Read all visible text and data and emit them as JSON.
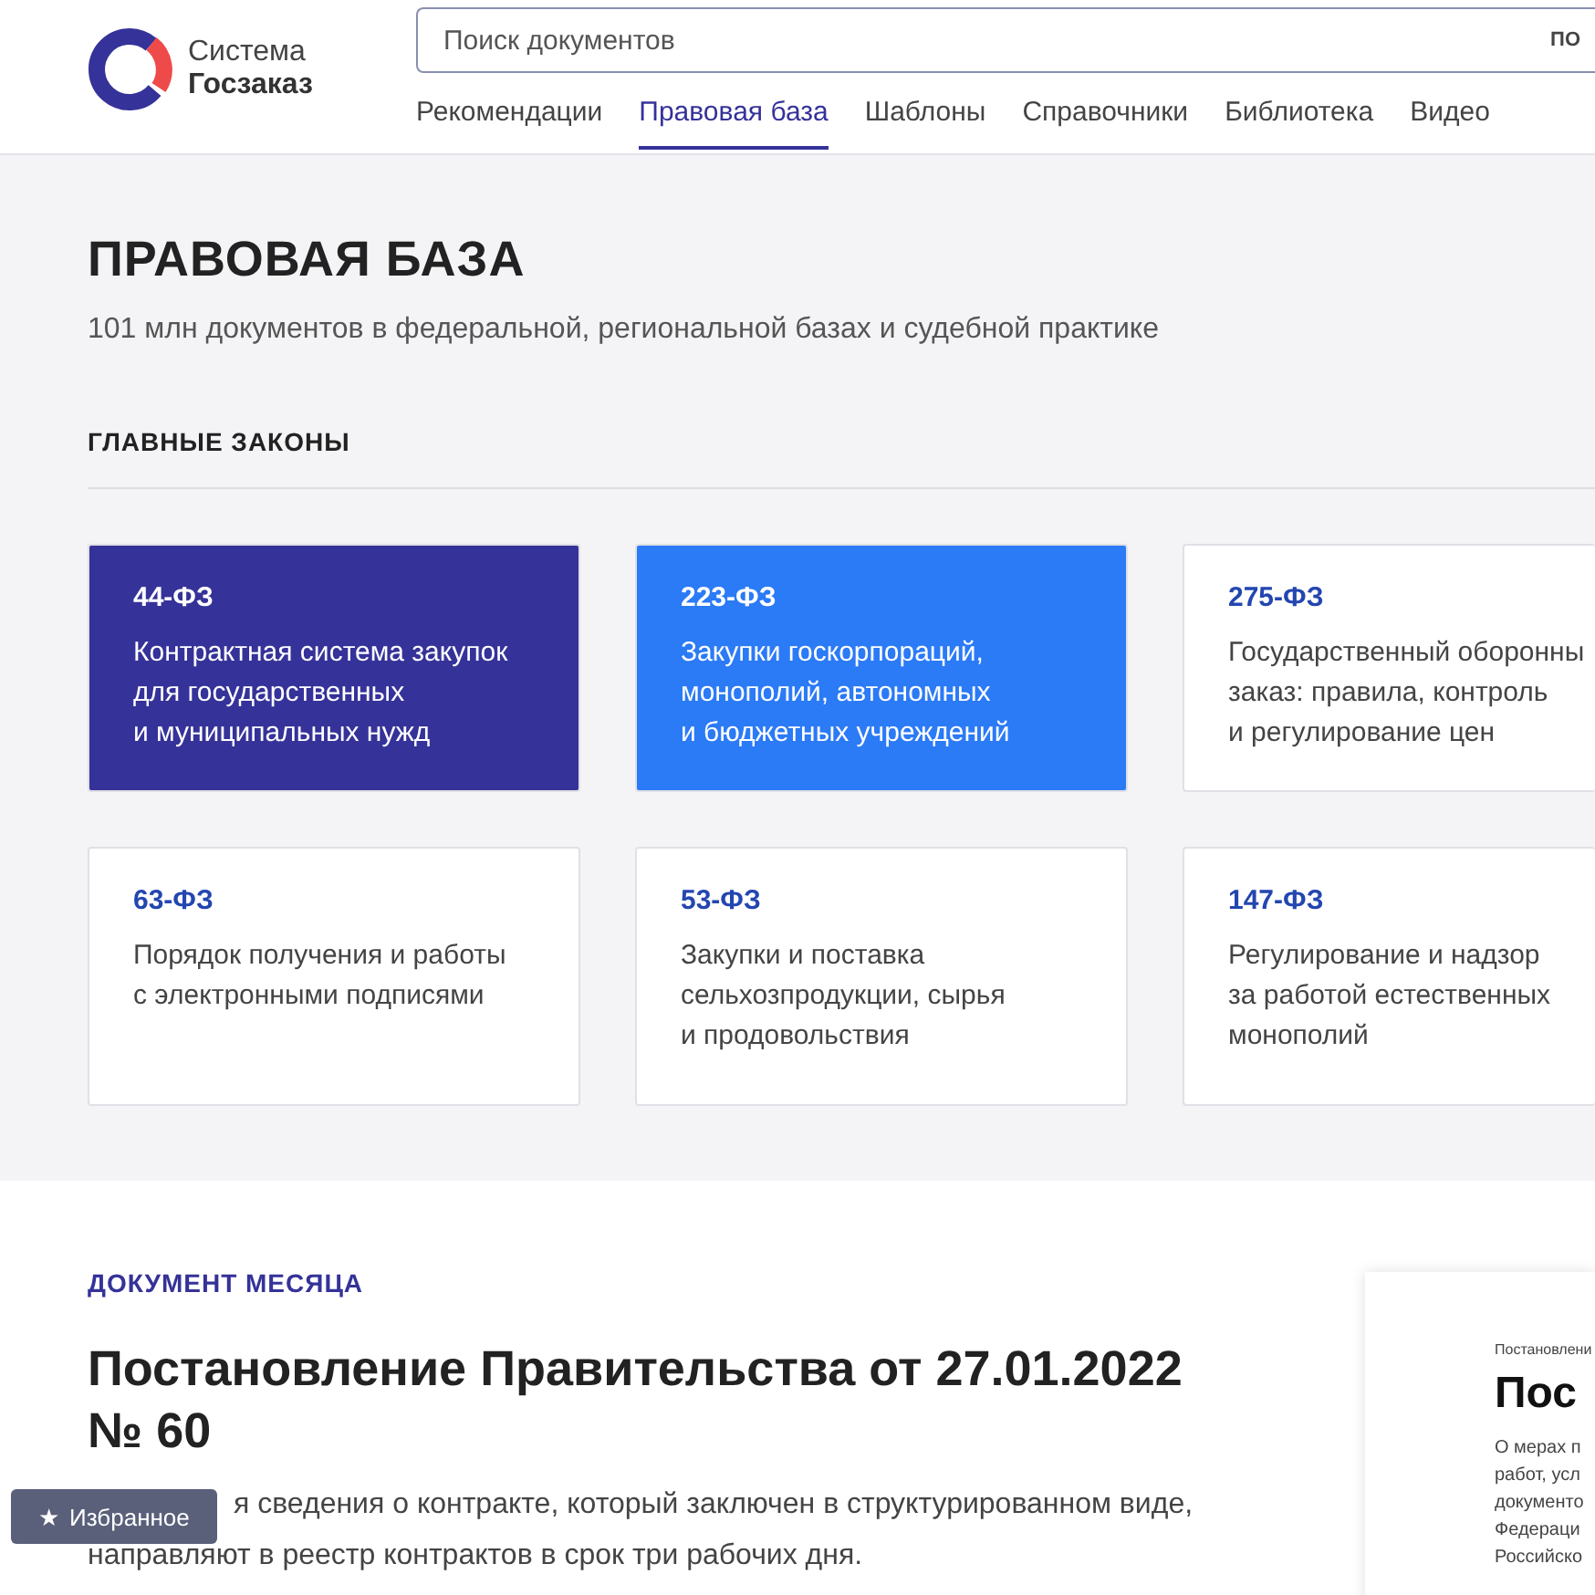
{
  "logo": {
    "line1": "Система",
    "line2": "Госзаказ"
  },
  "search": {
    "placeholder": "Поиск документов",
    "scope": "ПО"
  },
  "nav": [
    {
      "label": "Рекомендации",
      "selected": false
    },
    {
      "label": "Правовая база",
      "selected": true
    },
    {
      "label": "Шаблоны",
      "selected": false
    },
    {
      "label": "Справочники",
      "selected": false
    },
    {
      "label": "Библиотека",
      "selected": false
    },
    {
      "label": "Видео",
      "selected": false
    }
  ],
  "hero": {
    "title": "ПРАВОВАЯ БАЗА",
    "subtitle": "101 млн документов в федеральной, региональной базах и судебной практике",
    "section": "ГЛАВНЫЕ ЗАКОНЫ"
  },
  "laws": [
    {
      "code": "44-ФЗ",
      "lines": [
        "Контрактная система закупок",
        "для государственных",
        "и муниципальных нужд"
      ],
      "kind": "dark"
    },
    {
      "code": "223-ФЗ",
      "lines": [
        "Закупки госкорпораций,",
        "монополий, автономных",
        "и бюджетных учреждений"
      ],
      "kind": "blue"
    },
    {
      "code": "275-ФЗ",
      "lines": [
        "Государственный оборонны",
        "заказ: правила, контроль",
        "и регулирование цен"
      ],
      "kind": "plain"
    },
    {
      "code": "63-ФЗ",
      "lines": [
        "Порядок получения и работы",
        "с электронными подписями"
      ],
      "kind": "plain"
    },
    {
      "code": "53-ФЗ",
      "lines": [
        "Закупки и поставка",
        "сельхозпродукции, сырья",
        "и продовольствия"
      ],
      "kind": "plain"
    },
    {
      "code": "147-ФЗ",
      "lines": [
        "Регулирование и надзор",
        "за работой естественных",
        "монополий"
      ],
      "kind": "plain"
    }
  ],
  "document": {
    "label": "ДОКУМЕНТ МЕСЯЦА",
    "title_lines": [
      "Постановление Правительства от 27.01.2022",
      "№ 60"
    ],
    "text_lines": [
      "я сведения о контракте, который заключен в структурированном виде,",
      "направляют в реестр контрактов в срок три рабочих дня."
    ]
  },
  "preview": {
    "caption": "Постановлени",
    "title": "Пос",
    "lines": [
      "О мерах п",
      "работ, усл",
      "документо",
      "Федераци",
      "Российско"
    ]
  },
  "favorites": {
    "icon": "★",
    "label": "Избранное"
  }
}
